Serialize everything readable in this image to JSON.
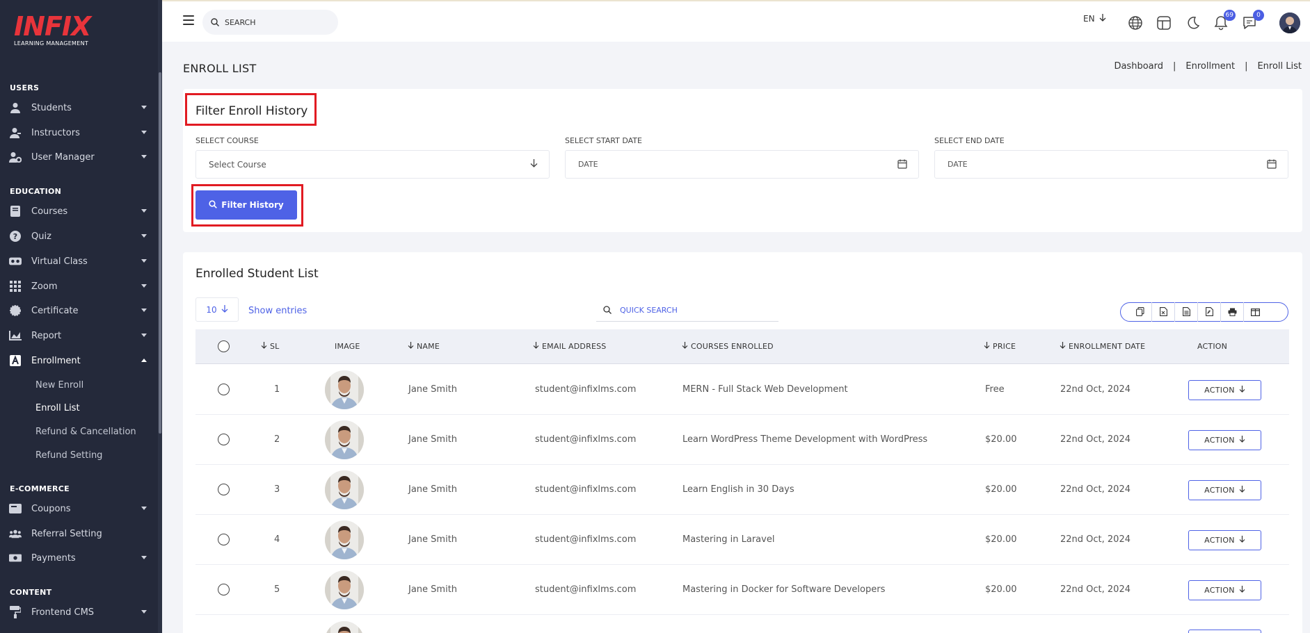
{
  "brand": {
    "logo_text": "INFIX",
    "tagline": "LEARNING MANAGEMENT"
  },
  "sidebar": {
    "sections": [
      {
        "title": "USERS",
        "items": [
          {
            "label": "Students",
            "icon": "user-icon",
            "caret": "down"
          },
          {
            "label": "Instructors",
            "icon": "instructor-icon",
            "caret": "down"
          },
          {
            "label": "User Manager",
            "icon": "user-gear-icon",
            "caret": "down"
          }
        ]
      },
      {
        "title": "EDUCATION",
        "items": [
          {
            "label": "Courses",
            "icon": "book-icon",
            "caret": "down"
          },
          {
            "label": "Quiz",
            "icon": "question-icon",
            "caret": "down"
          },
          {
            "label": "Virtual Class",
            "icon": "vr-icon",
            "caret": "down"
          },
          {
            "label": "Zoom",
            "icon": "grid-icon",
            "caret": "down"
          },
          {
            "label": "Certificate",
            "icon": "certificate-icon",
            "caret": "down"
          },
          {
            "label": "Report",
            "icon": "chart-icon",
            "caret": "down"
          },
          {
            "label": "Enrollment",
            "icon": "enrollment-icon",
            "caret": "up"
          }
        ]
      },
      {
        "title": "E-COMMERCE",
        "items": [
          {
            "label": "Coupons",
            "icon": "coupon-icon",
            "caret": "down"
          },
          {
            "label": "Referral Setting",
            "icon": "referral-icon",
            "caret": "none"
          },
          {
            "label": "Payments",
            "icon": "money-icon",
            "caret": "down"
          }
        ]
      },
      {
        "title": "CONTENT",
        "items": [
          {
            "label": "Frontend CMS",
            "icon": "paint-roller-icon",
            "caret": "down"
          }
        ]
      }
    ],
    "enrollment_sub": [
      "New Enroll",
      "Enroll List",
      "Refund & Cancellation",
      "Refund Setting"
    ]
  },
  "topbar": {
    "search_placeholder": "SEARCH",
    "language": "EN",
    "notifications_count": "69",
    "messages_count": "0"
  },
  "page": {
    "title": "ENROLL LIST",
    "breadcrumb": [
      "Dashboard",
      "Enrollment",
      "Enroll List"
    ]
  },
  "filter": {
    "title": "Filter Enroll History",
    "course_label": "SELECT COURSE",
    "course_value": "Select Course",
    "start_label": "SELECT START DATE",
    "start_placeholder": "DATE",
    "end_label": "SELECT END DATE",
    "end_placeholder": "DATE",
    "button": "Filter History"
  },
  "list": {
    "title": "Enrolled Student List",
    "entries_value": "10",
    "entries_label": "Show entries",
    "quick_search_placeholder": "QUICK SEARCH",
    "columns": [
      "SL",
      "IMAGE",
      "NAME",
      "EMAIL ADDRESS",
      "COURSES ENROLLED",
      "PRICE",
      "ENROLLMENT DATE",
      "ACTION"
    ],
    "action_label": "ACTION",
    "rows": [
      {
        "sl": "1",
        "name": "Jane Smith",
        "email": "student@infixlms.com",
        "course": "MERN - Full Stack Web Development",
        "price": "Free",
        "date": "22nd Oct, 2024"
      },
      {
        "sl": "2",
        "name": "Jane Smith",
        "email": "student@infixlms.com",
        "course": "Learn WordPress Theme Development with WordPress",
        "price": "$20.00",
        "date": "22nd Oct, 2024"
      },
      {
        "sl": "3",
        "name": "Jane Smith",
        "email": "student@infixlms.com",
        "course": "Learn English in 30 Days",
        "price": "$20.00",
        "date": "22nd Oct, 2024"
      },
      {
        "sl": "4",
        "name": "Jane Smith",
        "email": "student@infixlms.com",
        "course": "Mastering in Laravel",
        "price": "$20.00",
        "date": "22nd Oct, 2024"
      },
      {
        "sl": "5",
        "name": "Jane Smith",
        "email": "student@infixlms.com",
        "course": "Mastering in Docker for Software Developers",
        "price": "$20.00",
        "date": "22nd Oct, 2024"
      }
    ]
  },
  "colors": {
    "accent": "#4e62e6",
    "highlight": "#e11b22",
    "sidebar": "#24293a",
    "brand_red": "#e8343b"
  }
}
